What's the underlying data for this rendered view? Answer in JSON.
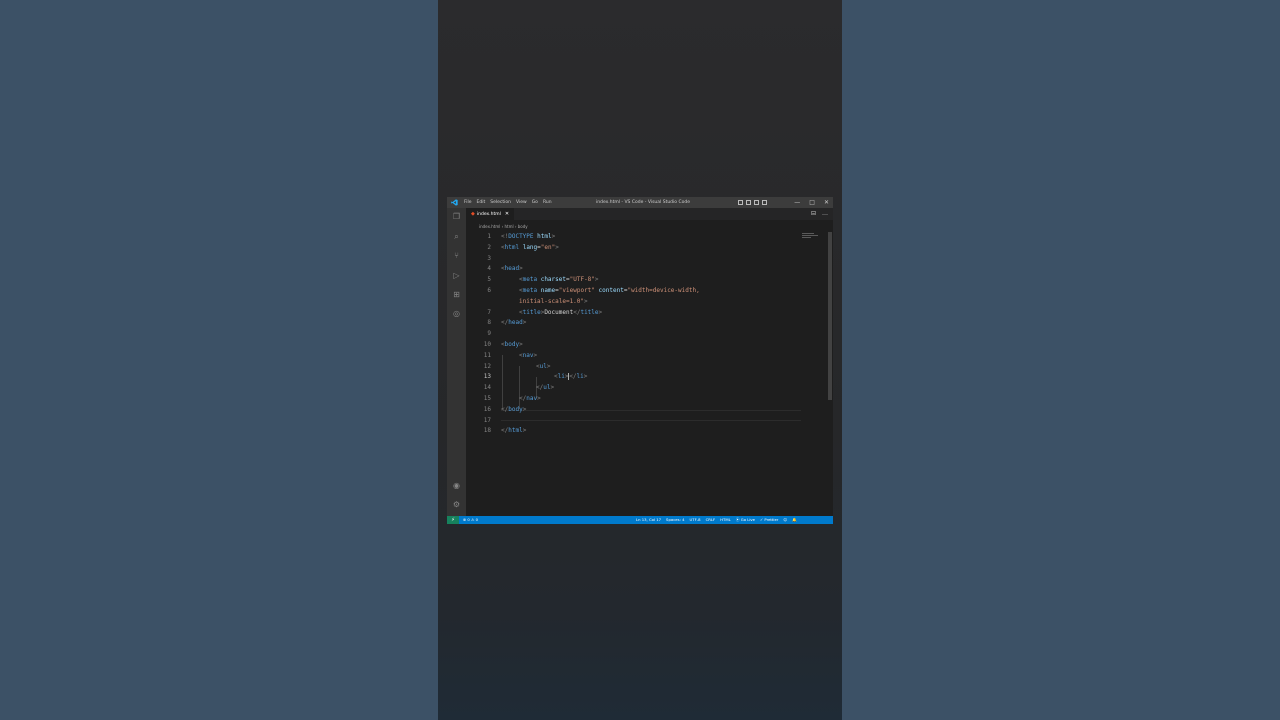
{
  "app": {
    "window_title": "index.html - VS Code - Visual Studio Code",
    "menu": [
      "File",
      "Edit",
      "Selection",
      "View",
      "Go",
      "Run"
    ],
    "window_controls": [
      "—",
      "□",
      "✕"
    ]
  },
  "activity_bar": {
    "icons": [
      "explorer-icon",
      "search-icon",
      "source-control-icon",
      "run-debug-icon",
      "extensions-icon",
      "remote-explorer-icon"
    ],
    "bottom_icons": [
      "accounts-icon",
      "settings-gear-icon"
    ]
  },
  "tab": {
    "label": "index.html",
    "close": "✕",
    "icon": "html5-icon"
  },
  "tab_actions": [
    "⊟",
    "…"
  ],
  "breadcrumb": [
    "index.html",
    "html",
    "body"
  ],
  "editor": {
    "lines": [
      {
        "n": "1"
      },
      {
        "n": "2"
      },
      {
        "n": "3"
      },
      {
        "n": "4"
      },
      {
        "n": "5"
      },
      {
        "n": "6"
      },
      {
        "n": ""
      },
      {
        "n": "7"
      },
      {
        "n": "8"
      },
      {
        "n": "9"
      },
      {
        "n": "10"
      },
      {
        "n": "11"
      },
      {
        "n": "12"
      },
      {
        "n": "13"
      },
      {
        "n": "14"
      },
      {
        "n": "15"
      },
      {
        "n": "16"
      },
      {
        "n": "17"
      },
      {
        "n": "18"
      }
    ],
    "tokens": {
      "doctype": "DOCTYPE",
      "html_kw": "html",
      "lang": "lang",
      "en": "\"en\"",
      "head": "head",
      "meta": "meta",
      "charset": "charset",
      "utf8": "\"UTF-8\"",
      "name": "name",
      "viewport": "\"viewport\"",
      "content": "content",
      "width": "\"width=device-width,",
      "initial": "initial-scale=1.0\"",
      "title": "title",
      "document": "Document",
      "body": "body",
      "nav": "nav",
      "ul": "ul",
      "li": "li"
    }
  },
  "status_bar": {
    "remote": "⚡",
    "problems": "⊗ 0 ⚠ 0",
    "position": "Ln 13, Col 17",
    "spaces": "Spaces: 4",
    "encoding": "UTF-8",
    "eol": "CRLF",
    "language": "HTML",
    "go_live": "⦿ Go Live",
    "prettier": "✓ Prettier",
    "feedback": "☺",
    "notifications": "🔔"
  }
}
